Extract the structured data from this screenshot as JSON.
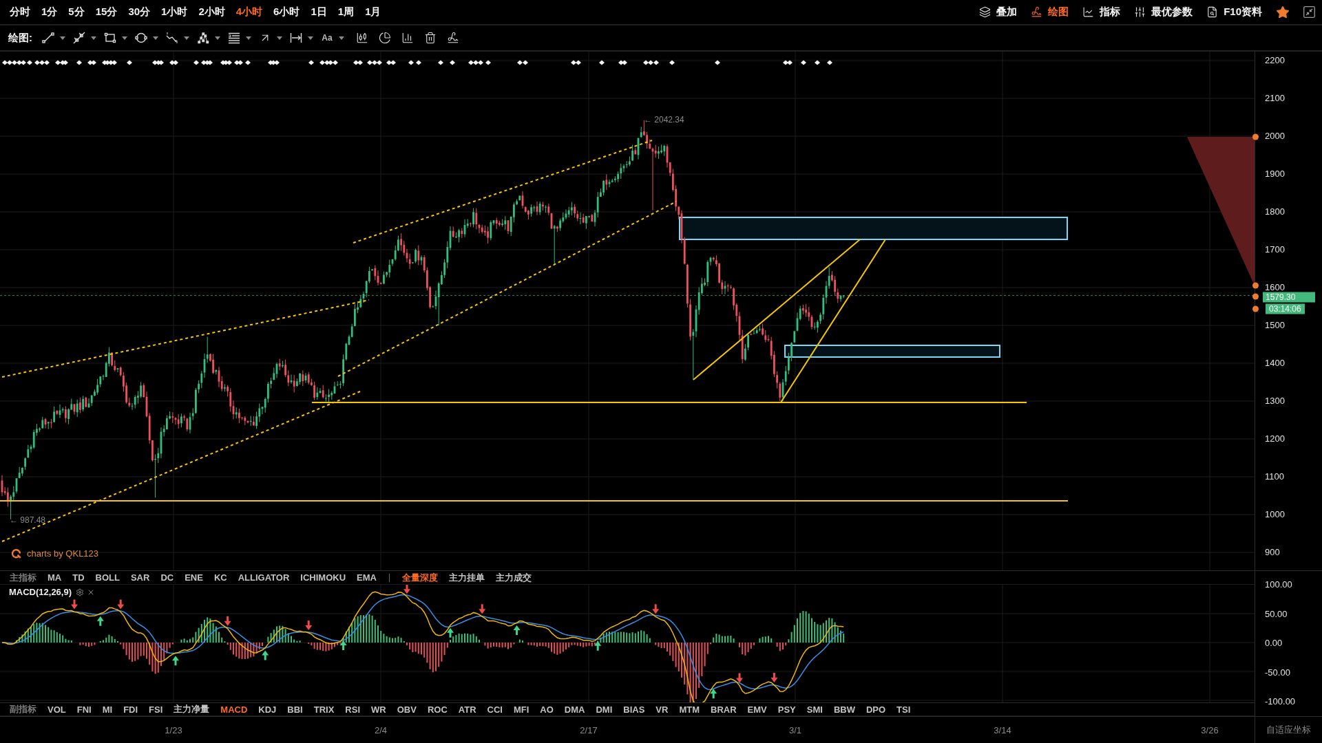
{
  "top_bar": {
    "periods": [
      {
        "label": "分时",
        "selected": false
      },
      {
        "label": "1分",
        "selected": false
      },
      {
        "label": "5分",
        "selected": false
      },
      {
        "label": "15分",
        "selected": false
      },
      {
        "label": "30分",
        "selected": false
      },
      {
        "label": "1小时",
        "selected": false
      },
      {
        "label": "2小时",
        "selected": false
      },
      {
        "label": "4小时",
        "selected": true
      },
      {
        "label": "6小时",
        "selected": false
      },
      {
        "label": "1日",
        "selected": false
      },
      {
        "label": "1周",
        "selected": false
      },
      {
        "label": "1月",
        "selected": false
      }
    ],
    "tools": [
      {
        "kind": "overlay",
        "label": "叠加",
        "active": false
      },
      {
        "kind": "draw",
        "label": "绘图",
        "active": true
      },
      {
        "kind": "indicator",
        "label": "指标",
        "active": false
      },
      {
        "kind": "params",
        "label": "最优参数",
        "active": false
      },
      {
        "kind": "f10",
        "label": "F10资料",
        "active": false
      }
    ],
    "favorite": true
  },
  "drawing_toolbar": {
    "label": "绘图:",
    "text_tool": "Aa"
  },
  "chart": {
    "price_axis": [
      "2200",
      "2100",
      "2000",
      "1900",
      "1800",
      "1700",
      "1600",
      "1500",
      "1400",
      "1300",
      "1200",
      "1100",
      "1000",
      "900"
    ],
    "high_label": "← 2042.34",
    "low_label": "← 987.48",
    "last_price": "1579.30",
    "countdown": "03:14:06",
    "brand": "charts by QKL123"
  },
  "main_indicators": {
    "label": "主指标",
    "items": [
      {
        "label": "MA",
        "selected": false
      },
      {
        "label": "TD",
        "selected": false
      },
      {
        "label": "BOLL",
        "selected": false
      },
      {
        "label": "SAR",
        "selected": false
      },
      {
        "label": "DC",
        "selected": false
      },
      {
        "label": "ENE",
        "selected": false
      },
      {
        "label": "KC",
        "selected": false
      },
      {
        "label": "ALLIGATOR",
        "selected": false
      },
      {
        "label": "ICHIMOKU",
        "selected": false
      },
      {
        "label": "EMA",
        "selected": false
      }
    ],
    "depth_items": [
      {
        "label": "全量深度",
        "selected": true
      },
      {
        "label": "主力挂单",
        "selected": false
      },
      {
        "label": "主力成交",
        "selected": false
      }
    ]
  },
  "macd": {
    "title": "MACD(12,26,9)",
    "axis": [
      "100.00",
      "50.00",
      "0.00",
      "-50.00",
      "-100.00"
    ]
  },
  "sub_indicators": {
    "label": "副指标",
    "items": [
      {
        "label": "VOL",
        "selected": false
      },
      {
        "label": "FNI",
        "selected": false
      },
      {
        "label": "MI",
        "selected": false
      },
      {
        "label": "FDI",
        "selected": false
      },
      {
        "label": "FSI",
        "selected": false
      },
      {
        "label": "主力净量",
        "selected": false
      },
      {
        "label": "MACD",
        "selected": true
      },
      {
        "label": "KDJ",
        "selected": false
      },
      {
        "label": "BBI",
        "selected": false
      },
      {
        "label": "TRIX",
        "selected": false
      },
      {
        "label": "RSI",
        "selected": false
      },
      {
        "label": "WR",
        "selected": false
      },
      {
        "label": "OBV",
        "selected": false
      },
      {
        "label": "ROC",
        "selected": false
      },
      {
        "label": "ATR",
        "selected": false
      },
      {
        "label": "CCI",
        "selected": false
      },
      {
        "label": "MFI",
        "selected": false
      },
      {
        "label": "AO",
        "selected": false
      },
      {
        "label": "DMA",
        "selected": false
      },
      {
        "label": "DMI",
        "selected": false
      },
      {
        "label": "BIAS",
        "selected": false
      },
      {
        "label": "VR",
        "selected": false
      },
      {
        "label": "MTM",
        "selected": false
      },
      {
        "label": "BRAR",
        "selected": false
      },
      {
        "label": "EMV",
        "selected": false
      },
      {
        "label": "PSY",
        "selected": false
      },
      {
        "label": "SMI",
        "selected": false
      },
      {
        "label": "BBW",
        "selected": false
      },
      {
        "label": "DPO",
        "selected": false
      },
      {
        "label": "TSI",
        "selected": false
      }
    ]
  },
  "time_axis": {
    "dates": [
      "1/23",
      "2/4",
      "2/17",
      "3/1",
      "3/14",
      "3/26"
    ],
    "scale_mode": "自适应坐标"
  }
}
